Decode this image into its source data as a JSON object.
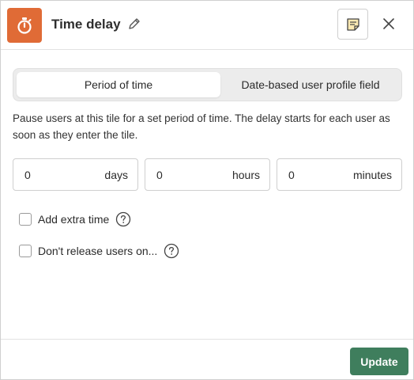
{
  "header": {
    "title": "Time delay",
    "tile_icon": "stopwatch-icon",
    "edit_icon": "pencil-icon",
    "notes_icon": "sticky-note-icon",
    "close_icon": "close-icon"
  },
  "segment": {
    "options": [
      "Period of time",
      "Date-based user profile field"
    ],
    "selected": "Period of time"
  },
  "description": "Pause users at this tile for a set period of time. The delay starts for each user as soon as they enter the tile.",
  "fields": [
    {
      "value": "0",
      "unit": "days"
    },
    {
      "value": "0",
      "unit": "hours"
    },
    {
      "value": "0",
      "unit": "minutes"
    }
  ],
  "options": [
    {
      "label": "Add extra time",
      "checked": false,
      "help_icon": "question-circle-icon"
    },
    {
      "label": "Don't release users on...",
      "checked": false,
      "help_icon": "question-circle-icon"
    }
  ],
  "footer": {
    "update_label": "Update"
  },
  "colors": {
    "tile_icon_bg": "#e06b36",
    "update_bg": "#3f7e5d",
    "segment_bg": "#ececec"
  }
}
